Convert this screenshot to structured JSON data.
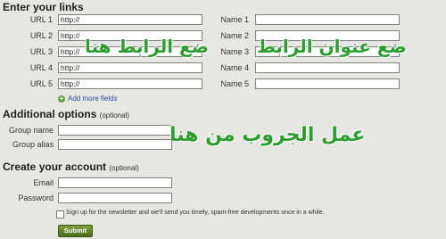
{
  "links_section": {
    "title": "Enter your links",
    "url_labels": [
      "URL 1",
      "URL 2",
      "URL 3",
      "URL 4",
      "URL 5"
    ],
    "url_values": [
      "http://",
      "http://",
      "http://",
      "http://",
      "http://"
    ],
    "name_labels": [
      "Name 1",
      "Name 2",
      "Name 3",
      "Name 4",
      "Name 5"
    ],
    "name_values": [
      "",
      "",
      "",
      "",
      ""
    ],
    "add_more_label": "Add more fields"
  },
  "additional_section": {
    "title": "Additional options",
    "optional_tag": "(optional)",
    "group_name_label": "Group name",
    "group_alias_label": "Group alias",
    "group_name_value": "",
    "group_alias_value": ""
  },
  "account_section": {
    "title": "Create your account",
    "optional_tag": "(optional)",
    "email_label": "Email",
    "password_label": "Password",
    "email_value": "",
    "password_value": "",
    "newsletter_text": "Sign up for the newsletter and we'll send you timely, spam-free developments once in a while.",
    "newsletter_checked": false,
    "submit_label": "Submit"
  },
  "overlays": {
    "put_link_here": "ضع الرابط هنا",
    "put_link_title": "ضع عنوان الرابط",
    "make_group_here": "عمل الجروب من هنا"
  },
  "colors": {
    "background": "#e6e6e2",
    "overlay_text": "#2b9e2f",
    "submit_button": "#5e8227",
    "link_text": "#2a4f9a"
  }
}
